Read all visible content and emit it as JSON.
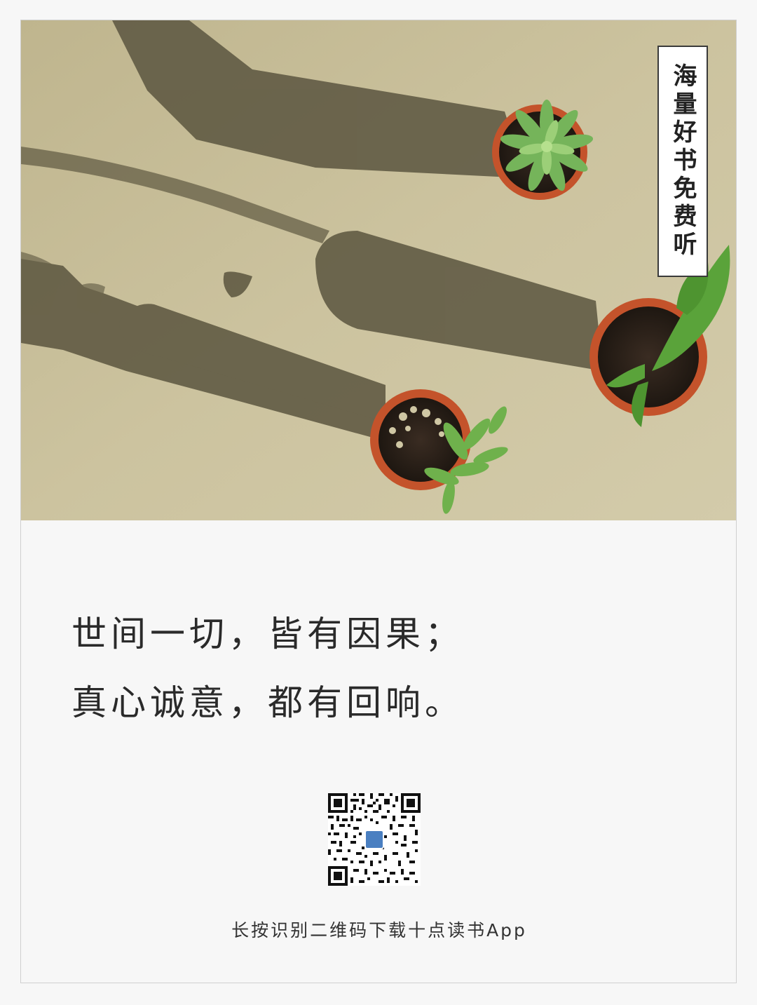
{
  "photo": {
    "subject": "three potted succulents casting long shadows on beige surface"
  },
  "tag": {
    "text": "海量好书免费听"
  },
  "quote": {
    "line1": "世间一切，皆有因果；",
    "line2": "真心诚意，都有回响。"
  },
  "qr": {
    "icon": "qr-code-icon"
  },
  "caption": {
    "text": "长按识别二维码下载十点读书App"
  },
  "colors": {
    "background": "#f7f7f7",
    "photo_bg": "#c7bd97",
    "pot": "#c9532a",
    "leaf": "#6cae4a",
    "text": "#2a2a2a"
  }
}
